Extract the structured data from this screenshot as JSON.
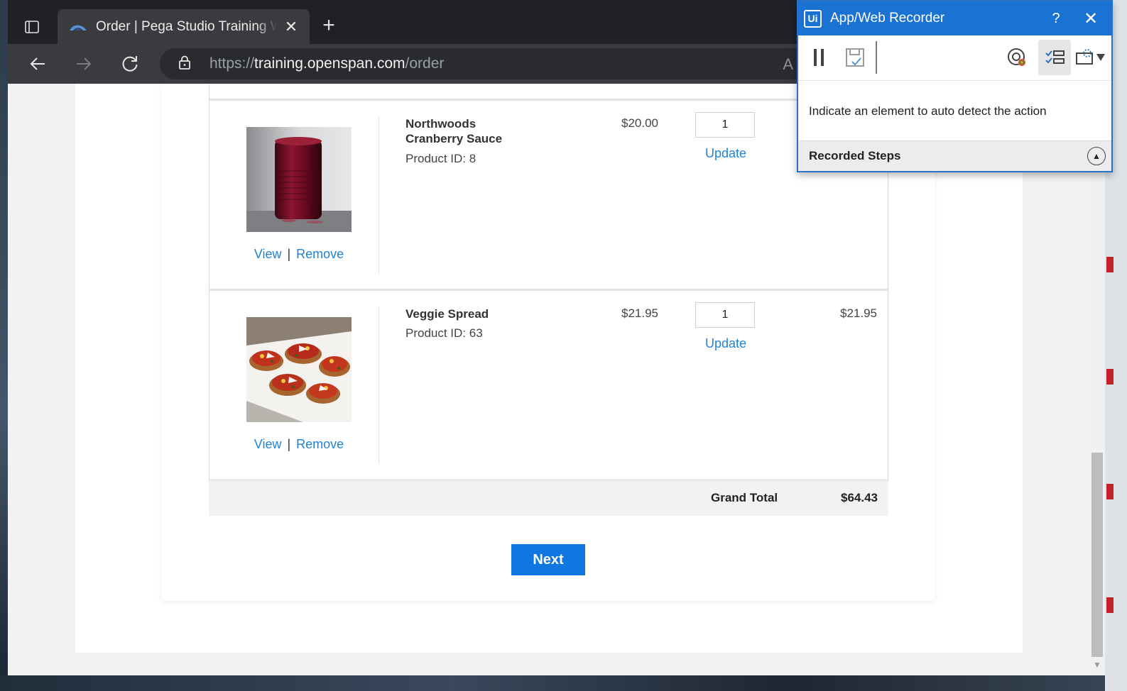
{
  "browser": {
    "tab": {
      "title": "Order | Pega Studio Training Website"
    },
    "address": {
      "scheme": "https://",
      "host": "training.openspan.com",
      "path": "/order"
    },
    "read_aloud_label": "A"
  },
  "cart": {
    "items": [
      {
        "name_line1": "Northwoods",
        "name_line2": "Cranberry Sauce",
        "product_id": "Product ID: 8",
        "price": "$20.00",
        "quantity": "1",
        "update_label": "Update",
        "line_total": "",
        "view_label": "View",
        "separator": "|",
        "remove_label": "Remove"
      },
      {
        "name_line1": "Veggie Spread",
        "name_line2": "",
        "product_id": "Product ID: 63",
        "price": "$21.95",
        "quantity": "1",
        "update_label": "Update",
        "line_total": "$21.95",
        "view_label": "View",
        "separator": "|",
        "remove_label": "Remove"
      }
    ],
    "grand_total_label": "Grand Total",
    "grand_total_value": "$64.43"
  },
  "next_label": "Next",
  "recorder": {
    "logo": "Ui",
    "title": "App/Web Recorder",
    "help": "?",
    "close": "✕",
    "instruction": "Indicate an element to auto detect the action",
    "recorded_steps_label": "Recorded Steps"
  },
  "colors": {
    "accent": "#1177e0",
    "link": "#1f82d6",
    "recorder_header": "#1a73d3"
  }
}
